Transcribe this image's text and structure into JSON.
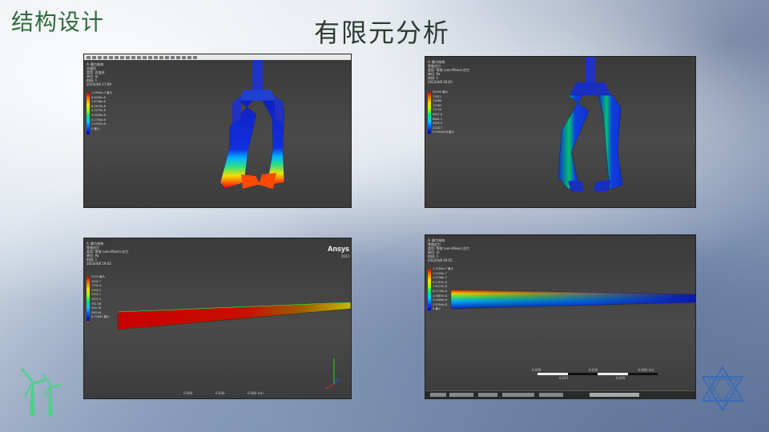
{
  "header": {
    "left_title": "结构设计",
    "center_title": "有限元分析"
  },
  "panels": {
    "top_left": {
      "info_lines": [
        "A: 静力结构",
        "总变形",
        "类型: 总变形",
        "单位: m",
        "时间: 1",
        "2023/4/8 17:09"
      ],
      "legend_header": "1.0004e-7 最大",
      "legend_values": [
        "8.8946e-8",
        "7.6748e-8",
        "6.4513e-8",
        "5.2275e-8",
        "4.0035e-8",
        "2.7794e-8",
        "1.5553e-8",
        "3.3128e-9"
      ],
      "legend_footer": "0 最小"
    },
    "top_right": {
      "info_lines": [
        "A: 静力结构",
        "等效应力",
        "类型: 等效 (von-Mises) 应力",
        "单位: Pa",
        "时间: 1",
        "2023/4/8 18:05"
      ],
      "legend_header": "20039 最大",
      "legend_values": [
        "17812",
        "15586",
        "13360",
        "11134",
        "8907.6",
        "6681.3",
        "4455.0",
        "2228.7"
      ],
      "legend_footer": "0.0054618 最小"
    },
    "bottom_left": {
      "info_lines": [
        "A: 静力结构",
        "等效应力",
        "类型: 等效 (von-Mises) 应力",
        "单位: Pa",
        "时间: 1",
        "2023/4/8 19:02"
      ],
      "legend_header": "2253 最大",
      "legend_values": [
        "2002.7",
        "1752.4",
        "1502.0",
        "1251.7",
        "1001.4",
        "751.08",
        "500.76",
        "250.44"
      ],
      "legend_footer": "0.12083 最小",
      "logo": "Ansys",
      "year": "2023",
      "scale_labels": [
        "0.000",
        "0.030",
        "0.060 (m)"
      ]
    },
    "bottom_right": {
      "info_lines": [
        "A: 静力结构",
        "等效应力",
        "类型: 等效 (von-Mises) 应力",
        "单位: m",
        "时间: 1",
        "2023/4/8 19:55"
      ],
      "legend_header": "1.3765e-7 最大",
      "legend_values": [
        "1.2235e-7",
        "1.0706e-7",
        "9.1767e-8",
        "7.6472e-8",
        "6.1178e-8",
        "4.5883e-8",
        "3.0589e-8",
        "1.5294e-8"
      ],
      "legend_footer": "0 最小",
      "scale_labels": [
        "0.000",
        "0.015",
        "0.030",
        "0.045",
        "0.060 (m)"
      ]
    }
  },
  "icons": {
    "bottom_left": "wind-turbine-icon",
    "bottom_right": "star-of-david-icon"
  },
  "colors": {
    "title_green": "#2f6b3a",
    "icon_green": "#4fd08a",
    "icon_blue": "#3a6bb5"
  }
}
